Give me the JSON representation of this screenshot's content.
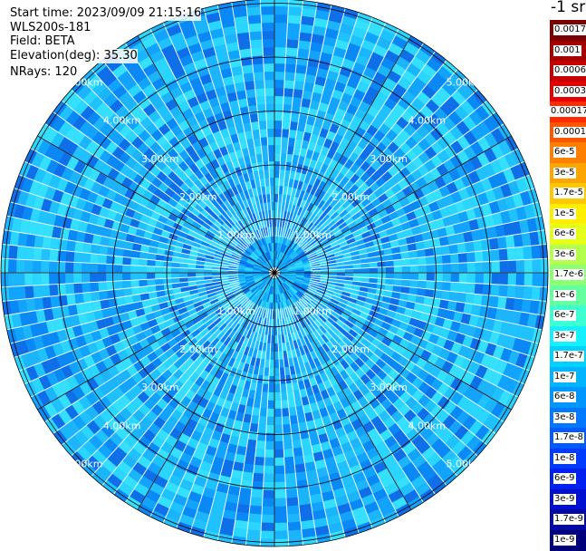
{
  "info": {
    "start_time": "Start time: 2023/09/09 21:15:16",
    "instrument": "WLS200s-181",
    "field": "Field: BETA",
    "elevation": "Elevation(deg): 35.30",
    "nrays": "NRays: 120"
  },
  "colorbar": {
    "title": "-1 sr",
    "labels": [
      "0.0017",
      "0.001",
      "0.0006",
      "0.0003",
      "0.00017",
      "0.0001",
      "6e-5",
      "3e-5",
      "1.7e-5",
      "1e-5",
      "6e-6",
      "3e-6",
      "1.7e-6",
      "1e-6",
      "6e-7",
      "3e-7",
      "1.7e-7",
      "1e-7",
      "6e-8",
      "3e-8",
      "1.7e-8",
      "1e-8",
      "6e-9",
      "3e-9",
      "1.7e-9",
      "1e-9"
    ],
    "colors": [
      "#7a0000",
      "#a50000",
      "#c80000",
      "#e60000",
      "#ff2a00",
      "#ff5500",
      "#ff8000",
      "#ffa500",
      "#ffc800",
      "#ffee00",
      "#e6ff1a",
      "#b4ff4b",
      "#8cff73",
      "#66ffa0",
      "#3cffd2",
      "#14f0ff",
      "#00d2ff",
      "#00b4ff",
      "#0096ff",
      "#0078ff",
      "#005aff",
      "#003cff",
      "#0020f0",
      "#0010d0",
      "#0008a8",
      "#00007a"
    ]
  },
  "range_ring_labels": [
    "1.00km",
    "2.00km",
    "3.00km",
    "4.00km",
    "5.00km"
  ],
  "colors": {
    "ring": "#000000",
    "beam_separator": "#ffffff",
    "palette_blues": [
      "#1fc1ff",
      "#12a3ff",
      "#2ad6ff",
      "#0a88f5",
      "#1cb4fa",
      "#35e0ff",
      "#0f6fe8"
    ]
  }
}
